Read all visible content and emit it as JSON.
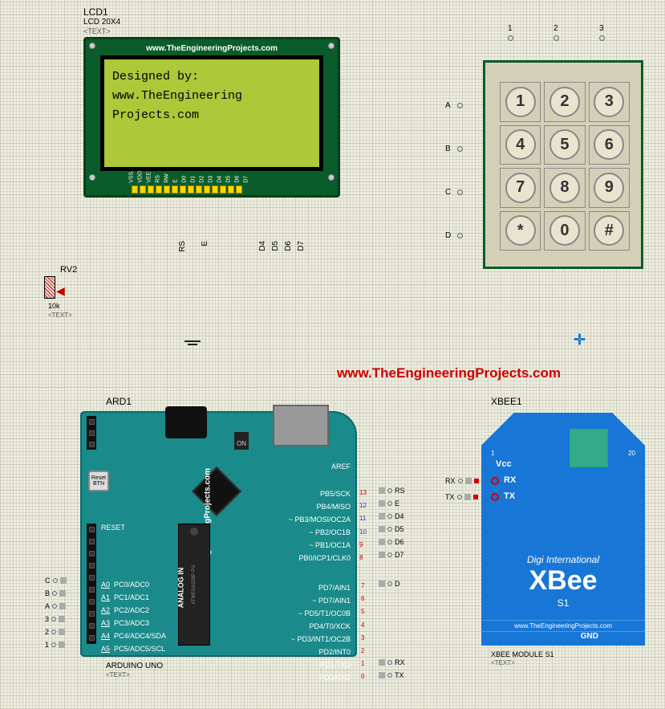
{
  "lcd": {
    "id": "LCD1",
    "model": "LCD 20X4",
    "textAttr": "<TEXT>",
    "url": "www.TheEngineeringProjects.com",
    "lines": {
      "l1": "Designed by:",
      "l2": "",
      "l3": "   www.TheEngineering",
      "l4": "   Projects.com"
    },
    "pins": [
      "VSS",
      "VDD",
      "VEE",
      "RS",
      "RW",
      "E",
      "D0",
      "D1",
      "D2",
      "D3",
      "D4",
      "D5",
      "D6",
      "D7"
    ],
    "wireLabels": {
      "rs": "RS",
      "e": "E",
      "d4": "D4",
      "d5": "D5",
      "d6": "D6",
      "d7": "D7"
    }
  },
  "rv2": {
    "id": "RV2",
    "value": "10k",
    "textAttr": "<TEXT>"
  },
  "keypad": {
    "cols": [
      "1",
      "2",
      "3"
    ],
    "rows": [
      "A",
      "B",
      "C",
      "D"
    ],
    "keys": [
      "1",
      "2",
      "3",
      "4",
      "5",
      "6",
      "7",
      "8",
      "9",
      "*",
      "0",
      "#"
    ]
  },
  "centerUrl": "www.TheEngineeringProjects.com",
  "arduino": {
    "id": "ARD1",
    "url": "www.TheEngineeringProjects.com",
    "model": "ARDUINO UNO",
    "textAttr": "<TEXT>",
    "analogLabel": "ANALOG IN",
    "reset": "Reset BTN",
    "resetPin": "RESET",
    "aref": "AREF",
    "onLed": "ON",
    "digitalNumbers": [
      "13",
      "12",
      "11",
      "10",
      "9",
      "8"
    ],
    "digitalNumbers2": [
      "7",
      "6",
      "5",
      "4",
      "3",
      "2",
      "1",
      "0"
    ],
    "rightPins": [
      "PB5/SCK",
      "PB4/MISO",
      "~ PB3/MOSI/OC2A",
      "~ PB2/OC1B",
      "~ PB1/OC1A",
      "PB0/ICP1/CLK0"
    ],
    "rightPins2": [
      "PD7/AIN1",
      "~ PD7/AIN1",
      "~ PD5/T1/OC0B",
      "PD4/T0/XCK",
      "~ PD3/INT1/OC2B",
      "PD2/INT0",
      "PD1/TXD",
      "PD0/RXD"
    ],
    "analogPins": [
      "A0",
      "A1",
      "A2",
      "A3",
      "A4",
      "A5"
    ],
    "analogPinsR": [
      "PC0/ADC0",
      "PC1/ADC1",
      "PC2/ADC2",
      "PC3/ADC3",
      "PC4/ADC4/SDA",
      "PC5/ADC5/SCL"
    ],
    "mcuName": "ATMEGA328P-PU"
  },
  "netLabels": {
    "analog": [
      "C",
      "B",
      "A",
      "3",
      "2",
      "1"
    ],
    "digitalTop": [
      "RS",
      "E",
      "D4",
      "D5",
      "D6",
      "D7"
    ],
    "digitalBottom": [
      "D",
      "",
      "",
      "",
      "",
      "",
      "RX",
      "TX"
    ]
  },
  "xbee": {
    "id": "XBEE1",
    "vcc": "Vcc",
    "pin1": "1",
    "pin20": "20",
    "rx": "RX",
    "tx": "TX",
    "digi": "Digi International",
    "name": "XBee",
    "series": "S1",
    "url": "www.TheEngineeringProjects.com",
    "gnd": "GND",
    "model": "XBEE MODULE S1",
    "textAttr": "<TEXT>",
    "rxNet": "RX",
    "txNet": "TX"
  }
}
